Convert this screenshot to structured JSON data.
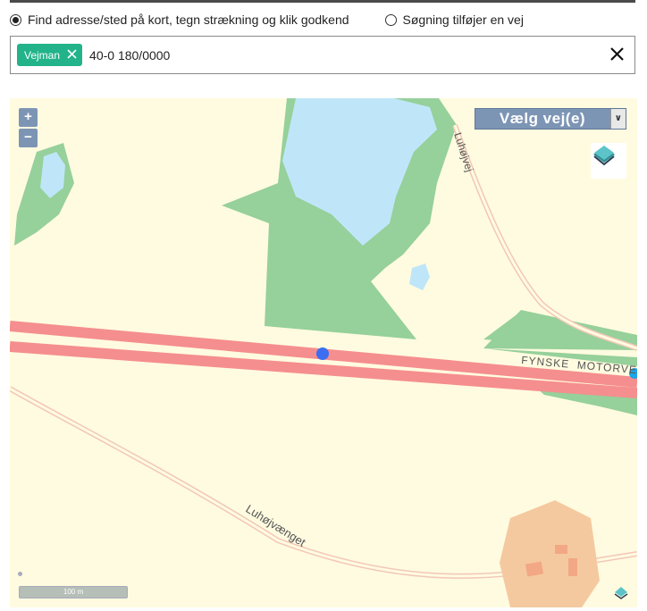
{
  "search_mode": {
    "options": [
      {
        "label": "Find adresse/sted på kort, tegn strækning og klik godkend",
        "selected": true
      },
      {
        "label": "Søgning tilføjer en vej",
        "selected": false
      }
    ]
  },
  "search": {
    "chip_label": "Vejman",
    "chip_remove_icon": "close-icon",
    "value": "40-0 180/0000",
    "clear_icon": "close-icon"
  },
  "map": {
    "zoom_in_label": "+",
    "zoom_out_label": "−",
    "road_select_label": "Vælg vej(e)",
    "road_select_chevron": "∨",
    "layers_icon": "layers-icon",
    "scale_label": "100 m",
    "labels": {
      "road_east": "Luhøjvej",
      "motorway": "FYNSKE  MOTORVEJ",
      "road_south": "Luhøjvænget"
    },
    "colors": {
      "land": "#fffbe0",
      "forest": "#96d09a",
      "water": "#bfe6f8",
      "motorway": "#f58e8e",
      "buildings": "#f5c9a0",
      "marker": "#3b6ef0"
    }
  }
}
